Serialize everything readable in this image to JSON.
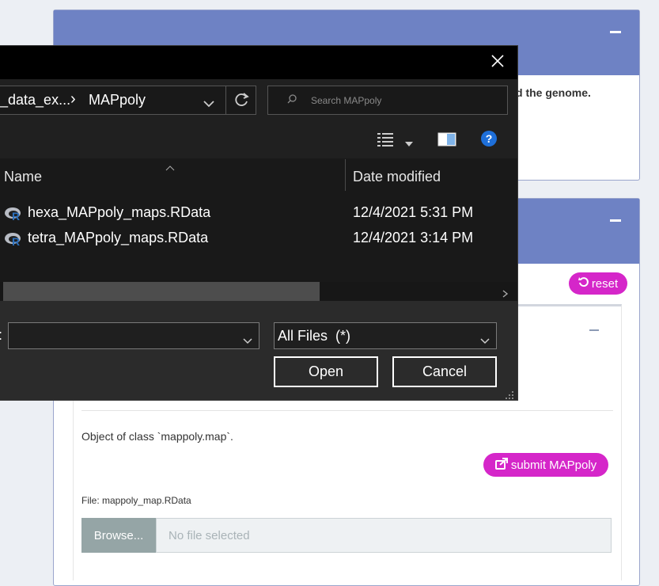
{
  "page": {
    "genome_text": "d the genome.",
    "reset_label": "reset",
    "object_text": "Object of class `mappoly.map`.",
    "submit_label": "submit MAPpoly",
    "file_label": "File: mappoly_map.RData",
    "browse_label": "Browse...",
    "file_placeholder": "No file selected"
  },
  "dialog": {
    "breadcrumb_parent": "_data_ex...",
    "breadcrumb_separator": "›",
    "breadcrumb_current": "MAPpoly",
    "search_placeholder": "Search MAPpoly",
    "columns": {
      "name": "Name",
      "date": "Date modified"
    },
    "files": [
      {
        "name": "hexa_MAPpoly_maps.RData",
        "date": "12/4/2021 5:31 PM"
      },
      {
        "name": "tetra_MAPpoly_maps.RData",
        "date": "12/4/2021 3:14 PM"
      }
    ],
    "filename_label_fragment": ":",
    "filename_value": "",
    "filter_value": "All Files  (*)",
    "open_label": "Open",
    "cancel_label": "Cancel"
  },
  "icons": [
    "close-icon",
    "chevron-down-icon",
    "refresh-icon",
    "search-icon",
    "view-options-icon",
    "preview-pane-icon",
    "help-icon",
    "r-file-icon",
    "reset-icon",
    "submit-icon",
    "resize-grip-icon"
  ],
  "colors": {
    "header": "#6e82c4",
    "accent": "#d526c9",
    "dialog_bg": "#202020",
    "help_blue": "#1e6fd9"
  }
}
